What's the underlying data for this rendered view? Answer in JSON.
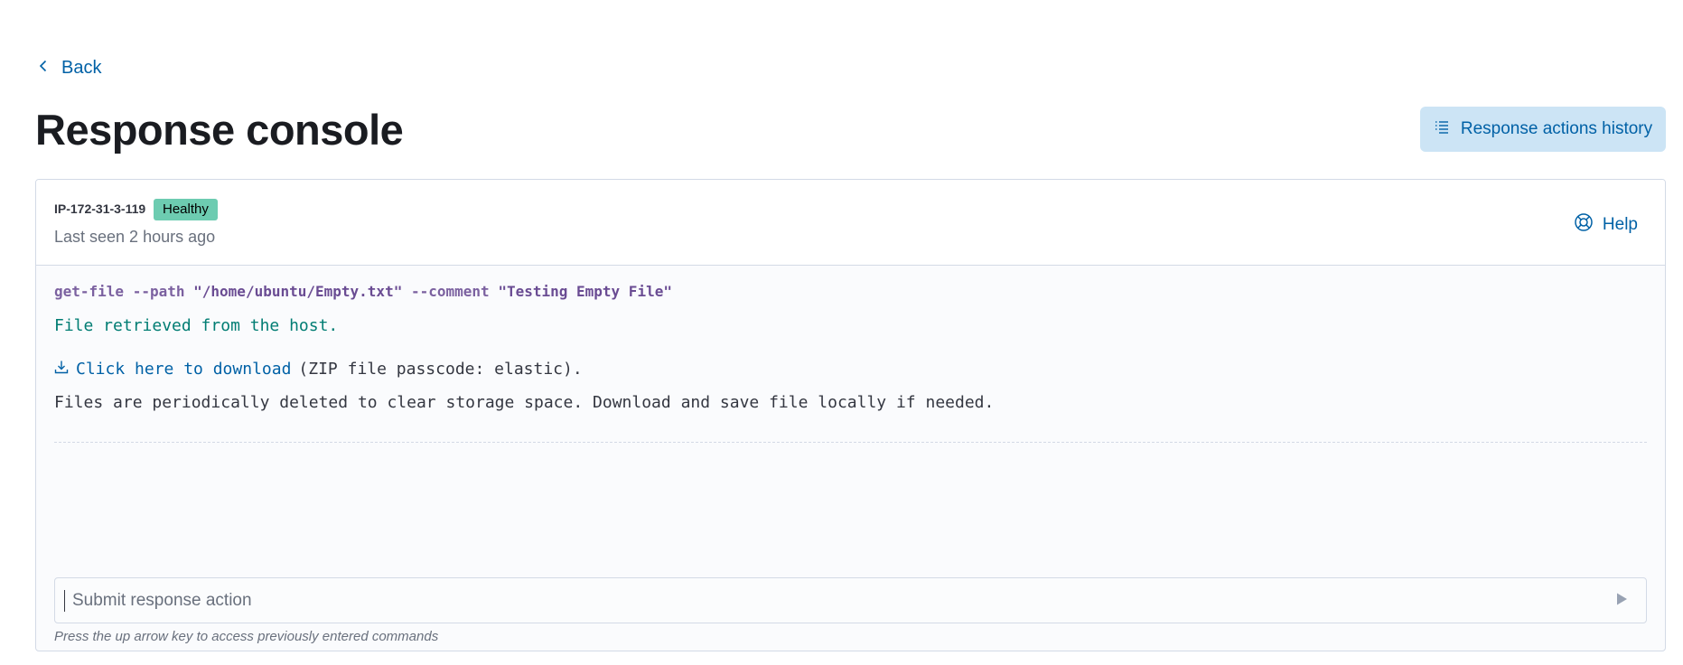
{
  "nav": {
    "back_label": "Back"
  },
  "header": {
    "title": "Response console",
    "history_button_label": "Response actions history"
  },
  "console": {
    "host_name": "IP-172-31-3-119",
    "status": "Healthy",
    "last_seen": "Last seen 2 hours ago",
    "help_label": "Help",
    "command": {
      "name": "get-file",
      "flag_path": "--path",
      "path_value": "\"/home/ubuntu/Empty.txt\"",
      "flag_comment": "--comment",
      "comment_value": "\"Testing Empty File\""
    },
    "result_message": "File retrieved from the host.",
    "download_link_label": "Click here to download",
    "download_suffix": "(ZIP file passcode: elastic).",
    "info_message": "Files are periodically deleted to clear storage space. Download and save file locally if needed.",
    "input_placeholder": "Submit response action",
    "input_hint": "Press the up arrow key to access previously entered commands"
  },
  "colors": {
    "accent": "#0061a6",
    "accent_bg": "#cce4f5",
    "healthy_badge": "#6dccb1",
    "success_text": "#017d73",
    "command_text": "#6a4c93"
  },
  "icons": {
    "back": "chevron-left-icon",
    "history": "list-icon",
    "help": "lifebuoy-icon",
    "download": "download-icon",
    "submit": "play-icon"
  }
}
